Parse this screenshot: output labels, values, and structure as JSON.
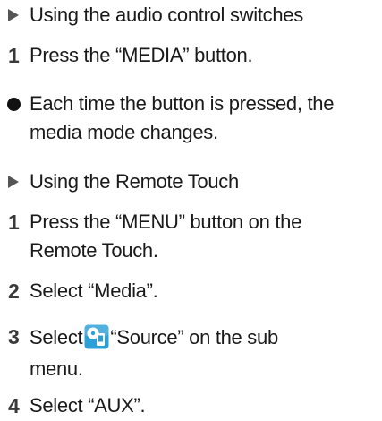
{
  "sections": [
    {
      "heading": "Using the audio control switches",
      "steps": [
        {
          "number": "1",
          "lines": [
            "Press the “MEDIA” button."
          ]
        }
      ],
      "notes": [
        {
          "lines": [
            "Each time the button is pressed, the",
            "media mode changes."
          ]
        }
      ]
    },
    {
      "heading": "Using the Remote Touch",
      "steps": [
        {
          "number": "1",
          "lines": [
            "Press the “MENU” button on the",
            "Remote Touch."
          ]
        },
        {
          "number": "2",
          "lines": [
            "Select “Media”."
          ]
        },
        {
          "number": "3",
          "before_icon": "Select",
          "icon": "source-icon",
          "after_icon": "“Source” on the sub",
          "lines": [
            "menu."
          ]
        },
        {
          "number": "4",
          "lines": [
            "Select “AUX”."
          ]
        }
      ]
    }
  ],
  "colors": {
    "text": "#1a1a1a",
    "heading_marker": "#555555",
    "step_number": "#3a3a3a",
    "bullet": "#111111",
    "icon_background": "#2b9fd6"
  }
}
